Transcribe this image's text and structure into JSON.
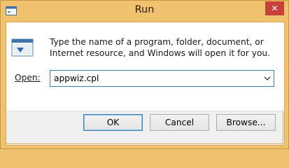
{
  "window": {
    "title": "Run",
    "close_glyph": "✕"
  },
  "icons": {
    "app": "run-icon",
    "dialog": "run-icon",
    "close": "close-icon",
    "dropdown": "chevron-down-icon"
  },
  "content": {
    "description": "Type the name of a program, folder, document, or Internet resource, and Windows will open it for you.",
    "open_label": "Open:",
    "open_value": "appwiz.cpl"
  },
  "buttons": {
    "ok": "OK",
    "cancel": "Cancel",
    "browse": "Browse..."
  },
  "colors": {
    "frame": "#f0c16e",
    "close_button": "#c7403a",
    "accent": "#3c7fb1"
  }
}
